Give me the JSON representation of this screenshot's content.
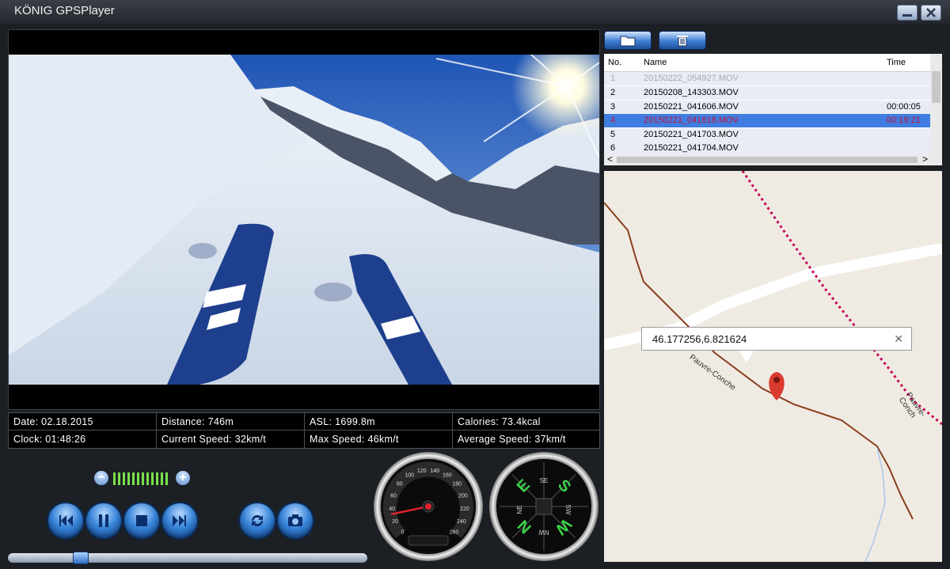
{
  "window": {
    "title": "KÖNIG GPSPlayer"
  },
  "stats": {
    "date": "Date: 02.18.2015",
    "distance": "Distance: 746m",
    "asl": "ASL: 1699.8m",
    "calories": "Calories: 73.4kcal",
    "clock": "Clock: 01:48:26",
    "current_speed": "Current Speed: 32km/t",
    "max_speed": "Max Speed: 46km/t",
    "average_speed": "Average Speed: 37km/t"
  },
  "player": {
    "volume_level": 0.8,
    "seek_progress": 0.18,
    "buttons": [
      "previous-icon",
      "pause-icon",
      "stop-icon",
      "next-icon",
      "repeat-icon",
      "camera-icon"
    ]
  },
  "speedometer": {
    "ticks": [
      "0",
      "20",
      "40",
      "60",
      "80",
      "100",
      "120",
      "140",
      "160",
      "180",
      "200",
      "220",
      "240",
      "260"
    ],
    "needle_value": 32
  },
  "compass": {
    "letters": {
      "n": "N",
      "e": "E",
      "s": "S",
      "w": "W",
      "ne": "NE",
      "se": "SE",
      "sw": "SW",
      "nw": "NW"
    }
  },
  "filelist": {
    "headers": {
      "no": "No.",
      "name": "Name",
      "time": "Time"
    },
    "rows": [
      {
        "no": "1",
        "name": "20150222_054927.MOV",
        "time": ""
      },
      {
        "no": "2",
        "name": "20150208_143303.MOV",
        "time": ""
      },
      {
        "no": "3",
        "name": "20150221_041606.MOV",
        "time": "00:00:05"
      },
      {
        "no": "4",
        "name": "20150221_041618.MOV",
        "time": "00:19:21"
      },
      {
        "no": "5",
        "name": "20150221_041703.MOV",
        "time": ""
      },
      {
        "no": "6",
        "name": "20150221_041704.MOV",
        "time": ""
      }
    ],
    "scroll_left": "<",
    "scroll_right": ">"
  },
  "map": {
    "coordinates": "46.177256,6.821624",
    "close": "✕",
    "road_label_1": "Pauvre-Conche",
    "road_label_2": "Pauvre-Conch"
  },
  "colors": {
    "accent": "#3f7de0",
    "selected_text": "#c3153b",
    "volume": "#7ae04a"
  }
}
